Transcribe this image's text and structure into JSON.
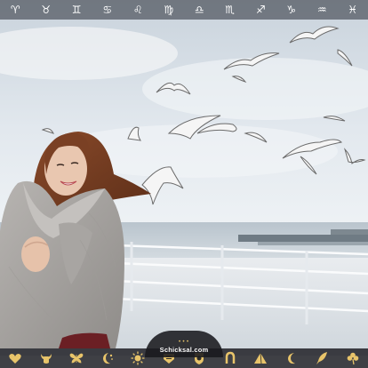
{
  "zodiac_bar": {
    "symbols": [
      "♈",
      "♉",
      "♊",
      "♋",
      "♌",
      "♍",
      "♎",
      "♏",
      "♐",
      "♑",
      "♒",
      "♓"
    ]
  },
  "logo": {
    "text": "Schicksal.com",
    "dots": "•••"
  },
  "bottom_bar": {
    "accent_color": "#e8c46a",
    "icons": [
      "heart-icon",
      "bull-icon",
      "butterfly-icon",
      "moon-stars-icon",
      "sun-icon",
      "badge-icon",
      "lion-shield-icon",
      "horseshoe-icon",
      "pyramid-icon",
      "crescent-moon-icon",
      "quill-icon",
      "clover-icon"
    ]
  },
  "photo": {
    "subject": "woman-in-grey-coat",
    "background": "seaside-with-seagulls"
  }
}
